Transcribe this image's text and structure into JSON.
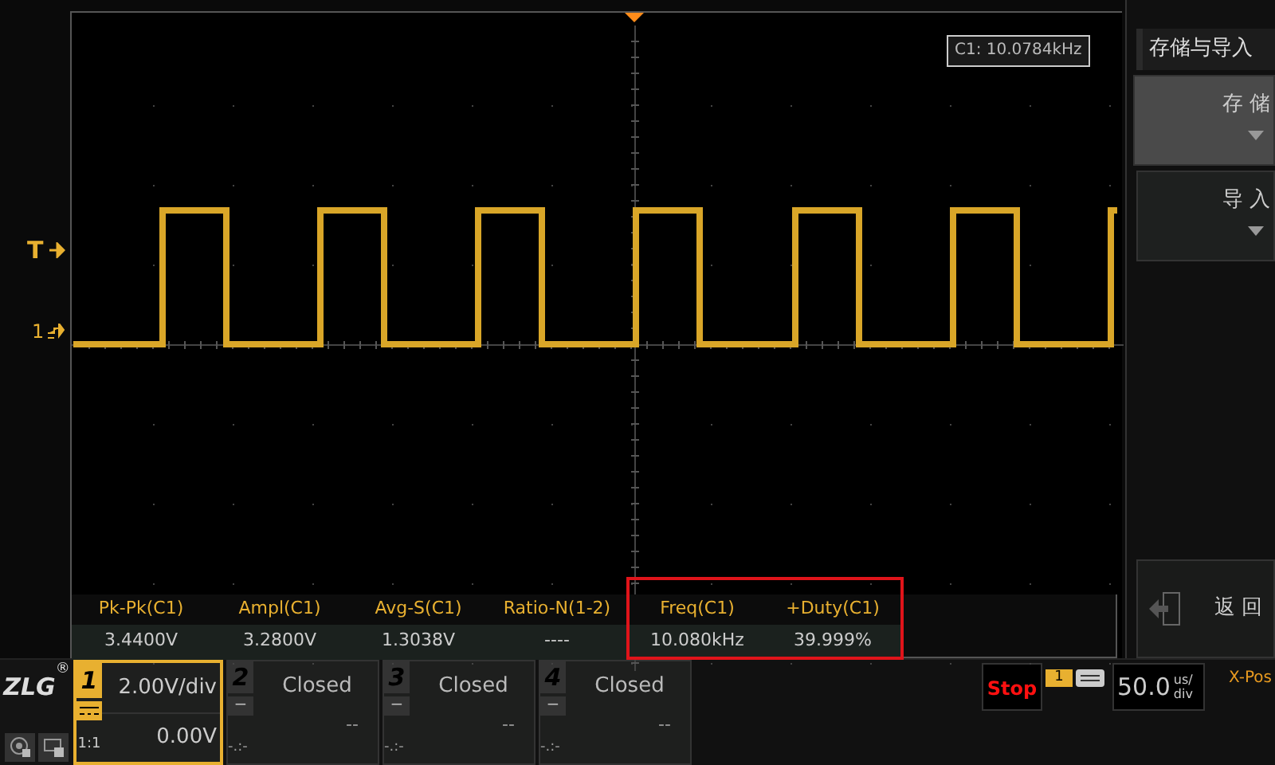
{
  "scope": {
    "cursor_readout": "C1: 10.0784kHz",
    "trigger_marker": "T",
    "channel_marker": "1"
  },
  "measurements": [
    {
      "label": "Pk-Pk(C1)",
      "value": "3.4400V",
      "highlighted": false
    },
    {
      "label": "Ampl(C1)",
      "value": "3.2800V",
      "highlighted": false
    },
    {
      "label": "Avg-S(C1)",
      "value": "1.3038V",
      "highlighted": false
    },
    {
      "label": "Ratio-N(1-2)",
      "value": "----",
      "highlighted": false
    },
    {
      "label": "Freq(C1)",
      "value": "10.080kHz",
      "highlighted": true
    },
    {
      "label": "+Duty(C1)",
      "value": "39.999%",
      "highlighted": true
    }
  ],
  "menu": {
    "title": "存储与导入",
    "items": [
      {
        "label": "存 储",
        "selected": true
      },
      {
        "label": "导 入",
        "selected": false
      }
    ],
    "back": "返 回"
  },
  "logo": {
    "text": "ZLG",
    "mark": "®"
  },
  "channels": [
    {
      "kind": "active",
      "number": "1",
      "scale": "2.00V/div",
      "offset": "0.00V",
      "probe": "1:1",
      "selected": true
    },
    {
      "kind": "closed",
      "number": "2",
      "status": "Closed",
      "badge": "−",
      "position": "-.:-",
      "value": "--",
      "selected": false
    },
    {
      "kind": "closed",
      "number": "3",
      "status": "Closed",
      "badge": "−",
      "position": "-.:-",
      "value": "--",
      "selected": false
    },
    {
      "kind": "closed",
      "number": "4",
      "status": "Closed",
      "badge": "−",
      "position": "-.:-",
      "value": "--",
      "selected": false
    }
  ],
  "status": {
    "run_state": "Stop",
    "trigger_channel": "1",
    "timebase": "50.0",
    "timebase_unit_top": "us/",
    "timebase_unit_bottom": "div",
    "xpos_label": "X-Pos"
  }
}
